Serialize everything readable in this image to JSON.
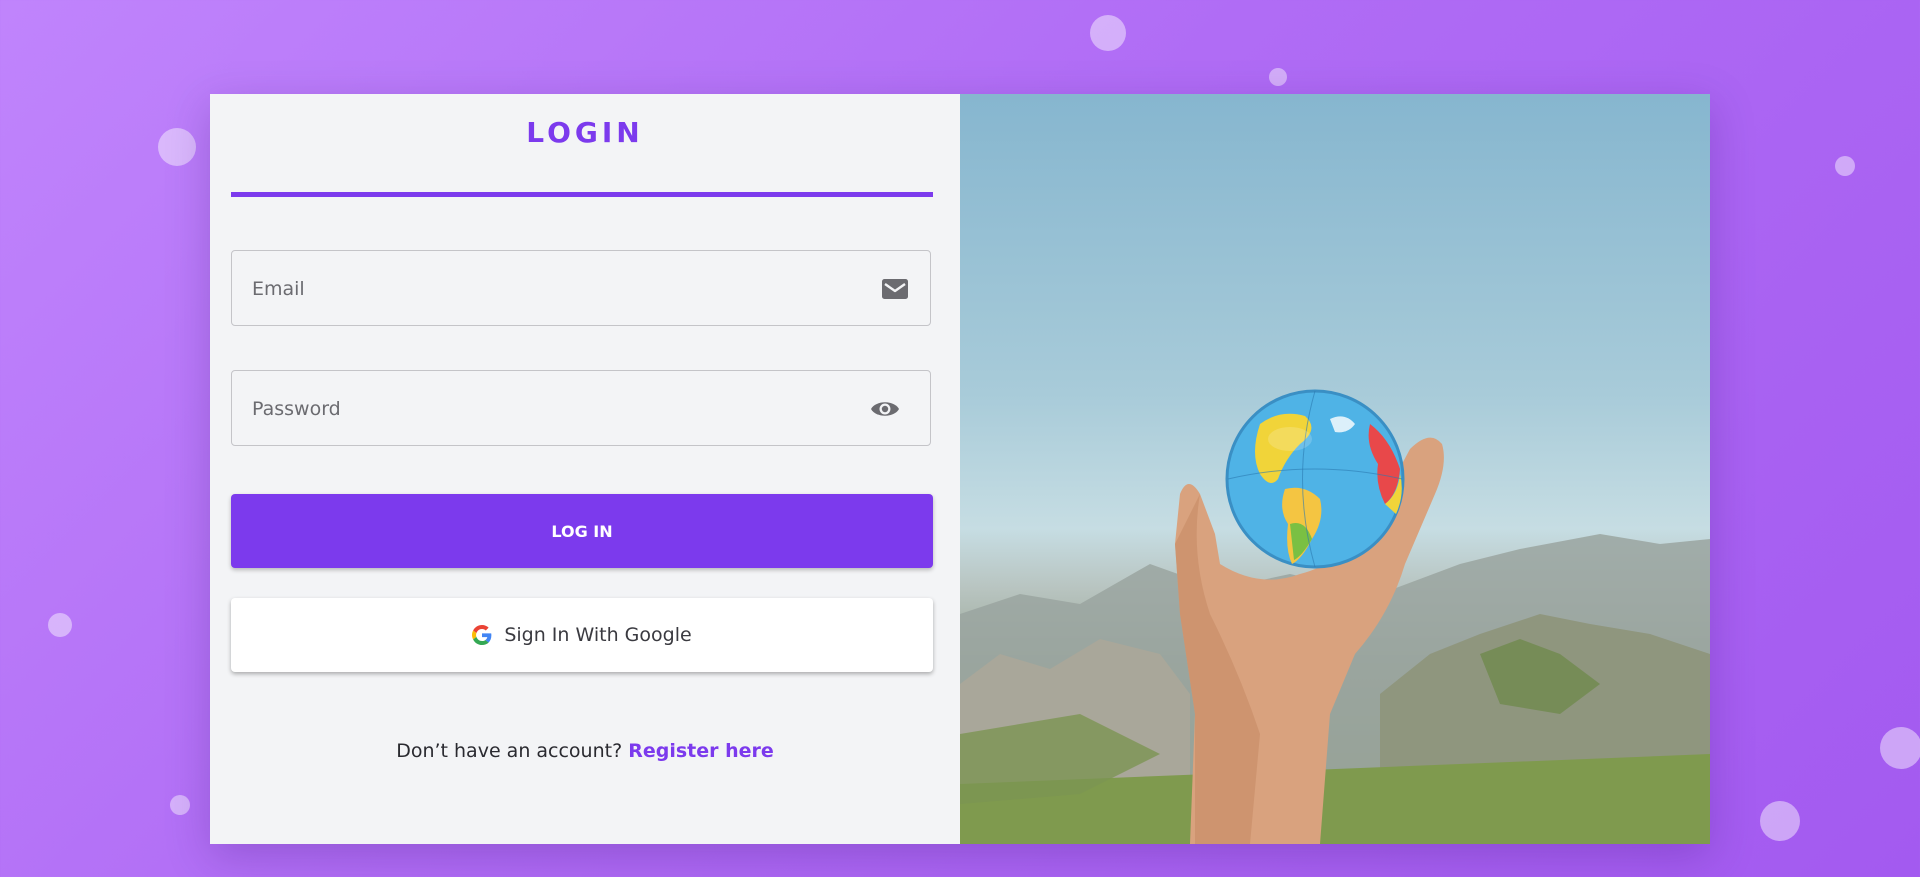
{
  "login": {
    "title": "LOGIN",
    "email_placeholder": "Email",
    "password_placeholder": "Password",
    "login_button": "LOG IN",
    "google_button": "Sign In With Google",
    "footer_prompt": "Don’t have an account?",
    "register_link": "Register here"
  },
  "icons": {
    "email": "mail-icon",
    "password": "eye-icon",
    "google": "google-g-logo"
  },
  "colors": {
    "accent": "#7c3aed",
    "background": "#b06cf5",
    "panel": "#f3f4f6"
  }
}
